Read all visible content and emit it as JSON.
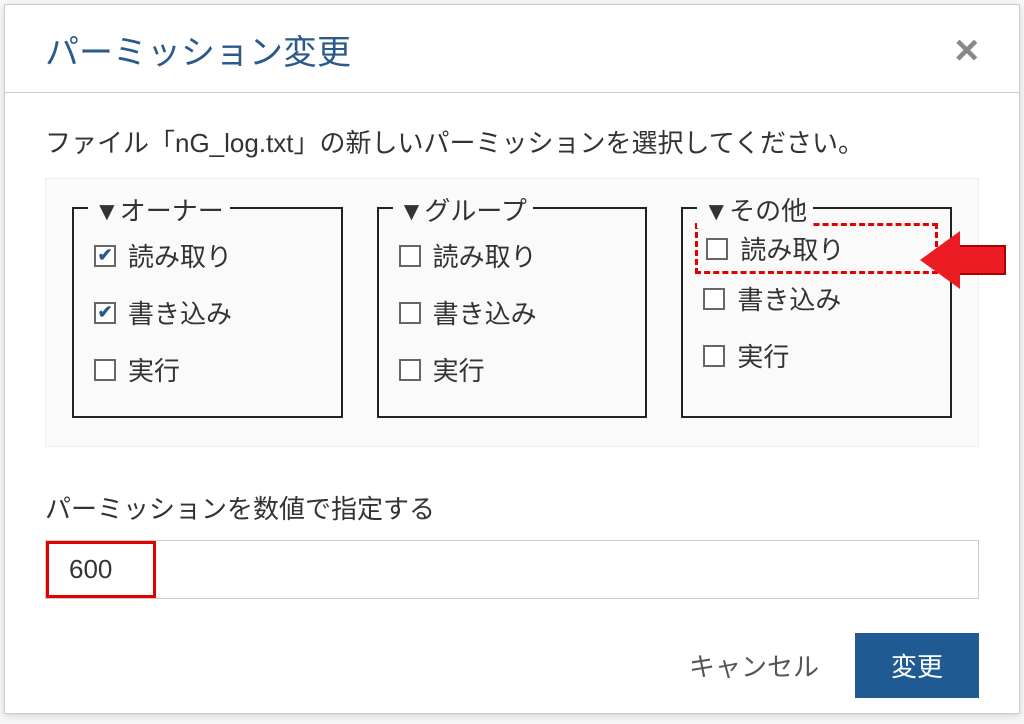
{
  "dialog": {
    "title": "パーミッション変更",
    "close_label": "×",
    "prompt": "ファイル「nG_log.txt」の新しいパーミッションを選択してください。",
    "groups": {
      "owner": {
        "legend": "▼オーナー",
        "read": {
          "label": "読み取り",
          "checked": true
        },
        "write": {
          "label": "書き込み",
          "checked": true
        },
        "execute": {
          "label": "実行",
          "checked": false
        }
      },
      "group": {
        "legend": "▼グループ",
        "read": {
          "label": "読み取り",
          "checked": false
        },
        "write": {
          "label": "書き込み",
          "checked": false
        },
        "execute": {
          "label": "実行",
          "checked": false
        }
      },
      "other": {
        "legend": "▼その他",
        "read": {
          "label": "読み取り",
          "checked": false
        },
        "write": {
          "label": "書き込み",
          "checked": false
        },
        "execute": {
          "label": "実行",
          "checked": false
        }
      }
    },
    "numeric": {
      "label": "パーミッションを数値で指定する",
      "value": "600"
    },
    "buttons": {
      "cancel": "キャンセル",
      "submit": "変更"
    }
  }
}
